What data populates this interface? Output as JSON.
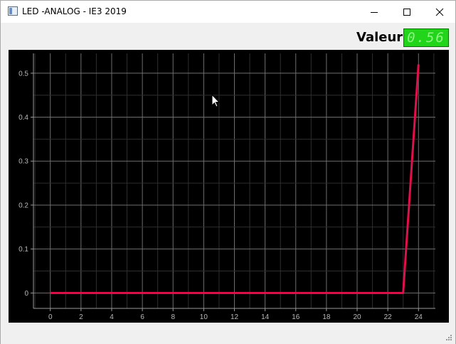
{
  "window": {
    "title": "LED -ANALOG - IE3 2019",
    "minimize_icon": "minimize-icon",
    "maximize_icon": "maximize-icon",
    "close_icon": "close-icon"
  },
  "header": {
    "value_label": "Valeur",
    "value_display": "0.56"
  },
  "colors": {
    "plot_background": "#000000",
    "line": "#e0104a",
    "grid": "#5a5a5a",
    "lcd_background": "#22d41a"
  },
  "chart_data": {
    "type": "line",
    "x": [
      0,
      1,
      2,
      3,
      4,
      5,
      6,
      7,
      8,
      9,
      10,
      11,
      12,
      13,
      14,
      15,
      16,
      17,
      18,
      19,
      20,
      21,
      22,
      23,
      24
    ],
    "series": [
      {
        "values": [
          0,
          0,
          0,
          0,
          0,
          0,
          0,
          0,
          0,
          0,
          0,
          0,
          0,
          0,
          0,
          0,
          0,
          0,
          0,
          0,
          0,
          0,
          0,
          0,
          0.52
        ]
      }
    ],
    "xticks": [
      "0",
      "2",
      "4",
      "6",
      "8",
      "10",
      "12",
      "14",
      "16",
      "18",
      "20",
      "22",
      "24"
    ],
    "yticks": [
      "0",
      "0.1",
      "0.2",
      "0.3",
      "0.4",
      "0.5"
    ],
    "xlim": [
      -1.1,
      25.1
    ],
    "ylim": [
      -0.035,
      0.545
    ],
    "grid": true
  }
}
